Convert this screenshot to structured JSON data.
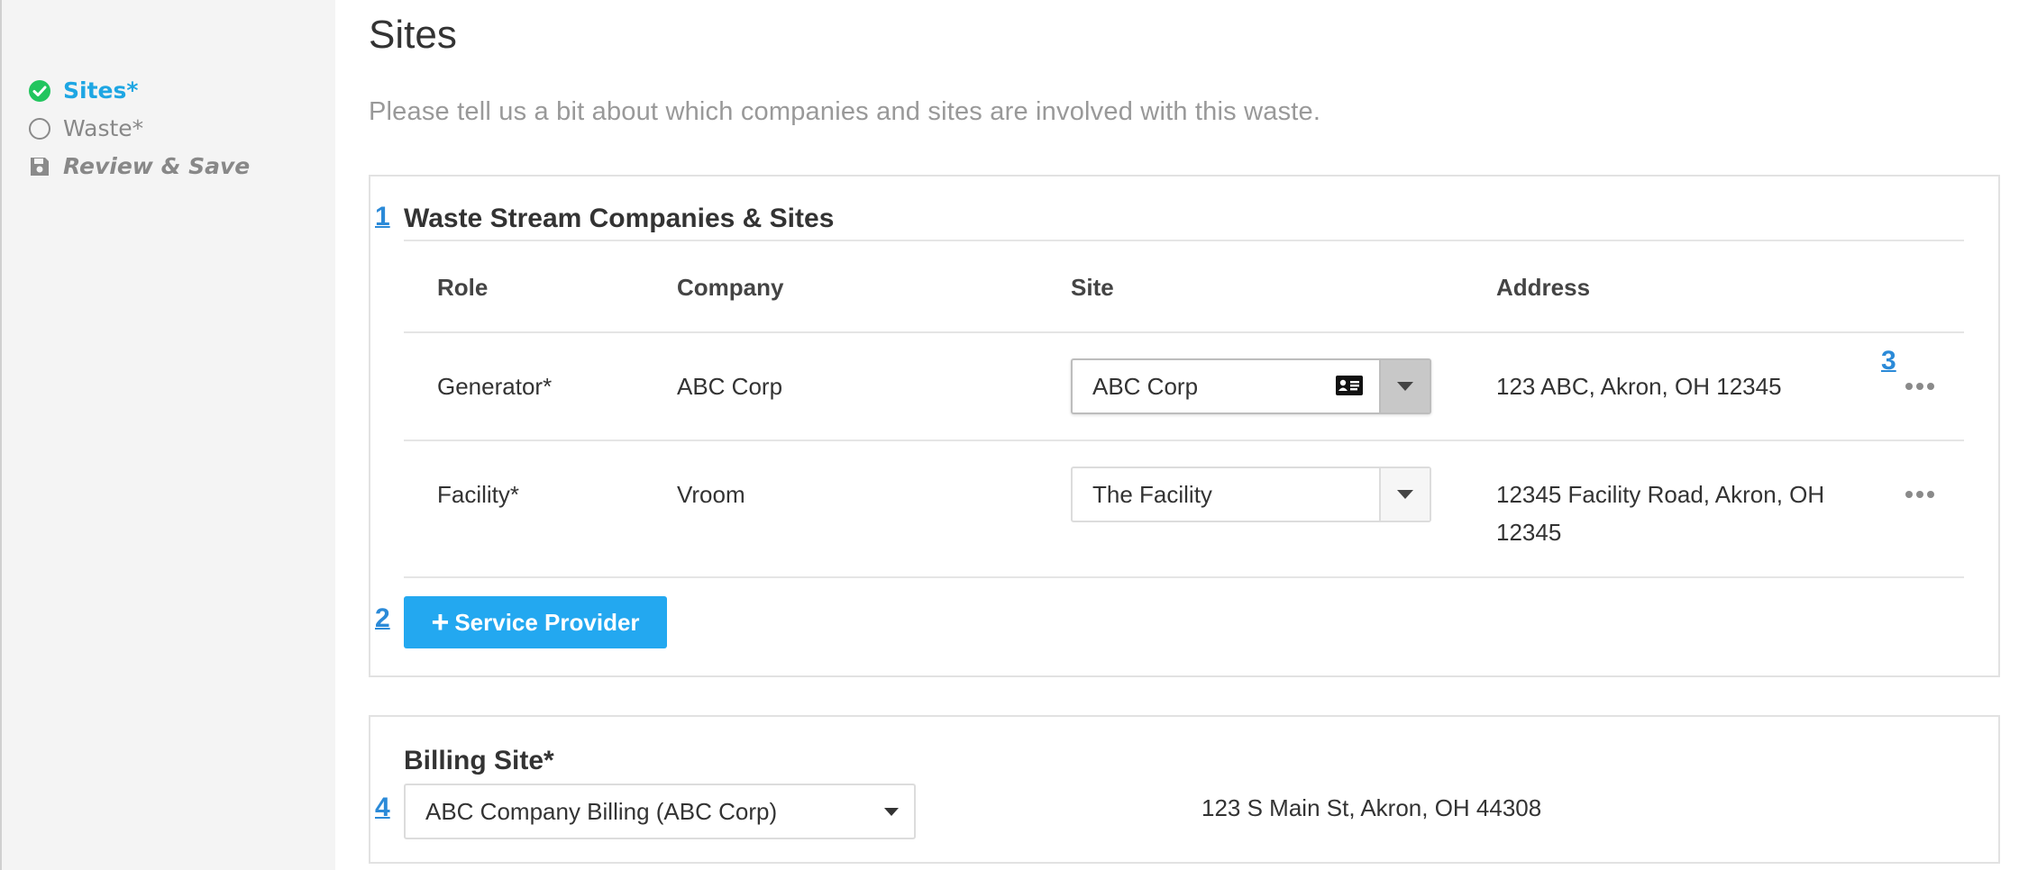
{
  "sidebar": {
    "steps": [
      {
        "label": "Sites*",
        "state": "complete",
        "icon": "check-circle-icon"
      },
      {
        "label": "Waste*",
        "state": "pending",
        "icon": "empty-circle-icon"
      },
      {
        "label": "Review & Save",
        "state": "pending",
        "icon": "floppy-disk-icon"
      }
    ]
  },
  "page": {
    "title": "Sites",
    "intro": "Please tell us a bit about which companies and sites are involved with this waste."
  },
  "markers": [
    "1",
    "2",
    "3",
    "4"
  ],
  "companies_section": {
    "title": "Waste Stream Companies & Sites",
    "columns": [
      "Role",
      "Company",
      "Site",
      "Address"
    ],
    "rows": [
      {
        "role": "Generator*",
        "company": "ABC Corp",
        "site": "ABC Corp",
        "address": "123 ABC, Akron, OH 12345"
      },
      {
        "role": "Facility*",
        "company": "Vroom",
        "site": "The Facility",
        "address_line1": "12345 Facility Road, Akron, OH",
        "address_line2": "12345"
      }
    ],
    "add_button": "Service Provider"
  },
  "billing": {
    "title": "Billing Site*",
    "selected": "ABC Company Billing (ABC Corp)",
    "address": "123 S Main St, Akron, OH 44308"
  },
  "colors": {
    "accent": "#1ea6e3",
    "button": "#23a8f0",
    "success": "#22c55e",
    "marker": "#2b8ad8"
  }
}
